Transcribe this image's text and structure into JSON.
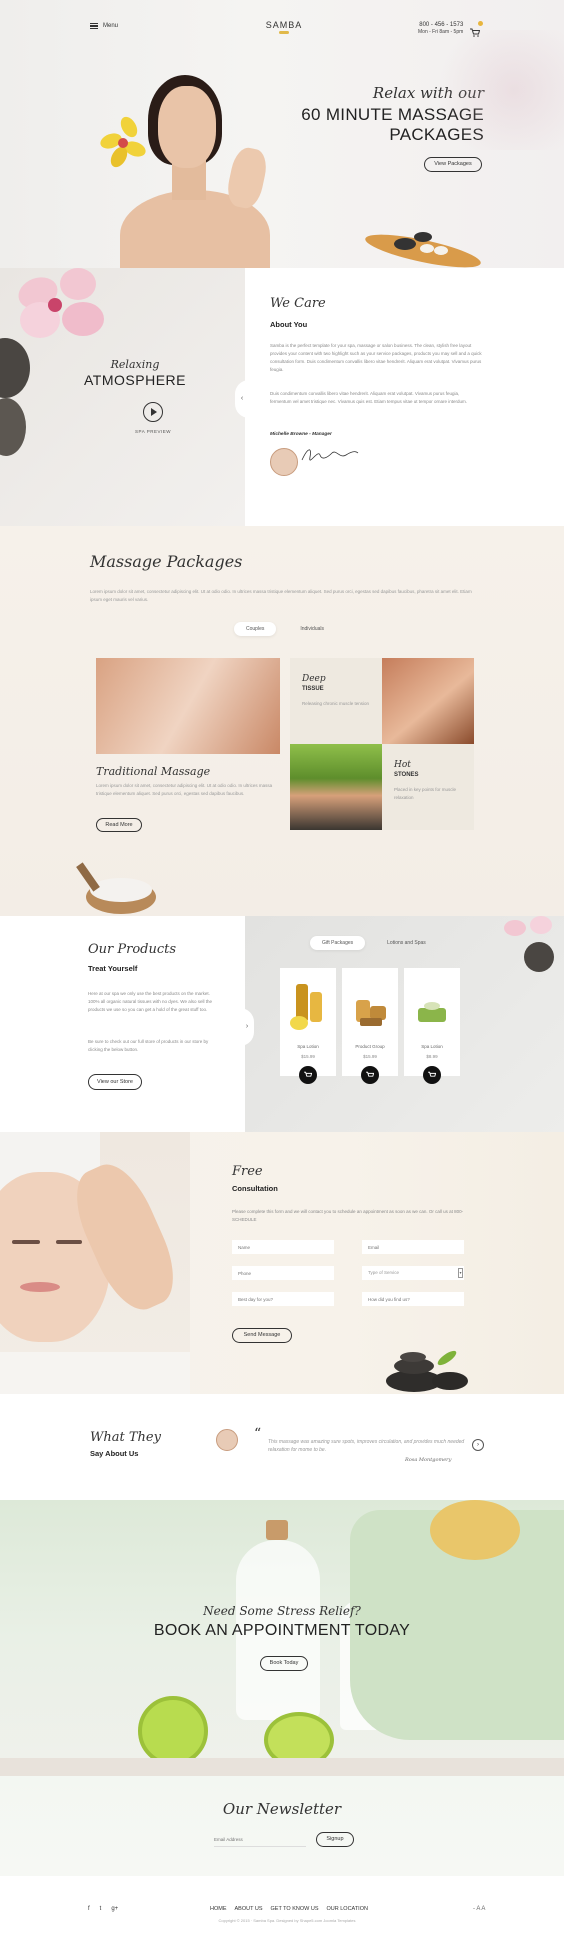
{
  "header": {
    "menu_label": "Menu",
    "logo": "SAMBA",
    "phone": "800 - 456 - 1573",
    "hours": "Mon - Fri 8am - 5pm"
  },
  "hero": {
    "subtitle": "Relax with our",
    "title_line1": "60 MINUTE MASSAGE",
    "title_line2": "PACKAGES",
    "button": "View Packages"
  },
  "atmosphere": {
    "script": "Relaxing",
    "title": "ATMOSPHERE",
    "preview_label": "SPA PREVIEW"
  },
  "about": {
    "script": "We Care",
    "title": "About You",
    "para1": "Samba is the perfect template for your spa, massage or salon business. The clean, stylish free layout provides your content with two highlight such as your service packages, products you may sell and a quick consultation form. Duis condimentum convallis libero vitae hendrerit. Aliquam erat volutpat. Vivamus purus feugia.",
    "para2": "Duis condimentum convallis libero vitae hendrerit. Aliquam erat volutpat. Vivamus purus feugia, fermentum vel amet tristique nec. Vivamus quis est. Etiam tempus vitae ut tempor ornare interdum.",
    "author": "Michelle Browne - Manager"
  },
  "packages": {
    "title": "Massage Packages",
    "desc": "Lorem ipsum dolor sit amet, consectetur adipiscing elit. Ut at odio odio. In ultrices massa tristique elementum aliquet. Sed purus orci, egestas sed dapibus faucibus, pharetra sit amet elit. Etiam ipsum eget mauris vel varius.",
    "tabs": [
      "Couples",
      "Individuals"
    ],
    "deep": {
      "script": "Deep",
      "title": "TISSUE",
      "desc": "Releasing chronic muscle tension"
    },
    "hot": {
      "script": "Hot",
      "title": "STONES",
      "desc": "Placed in key points for muscle relaxation"
    },
    "traditional": {
      "title": "Traditional Massage",
      "desc": "Lorem ipsum dolor sit amet, consectetur adipiscing elit. Ut at odio odio. In ultrices massa tristique elementum aliquet. Sed purus orci, egestas sed dapibus faucibus.",
      "button": "Read More"
    }
  },
  "products": {
    "script": "Our Products",
    "title": "Treat Yourself",
    "para1": "Here at our spa we only use the best products on the market. 100% all organic natural tissues with no dyes. We also sell the products we use so you can get a hold of the great stuff too.",
    "para2": "Be sure to check out our full store of products in our store by clicking the below button.",
    "button": "View our Store",
    "tabs": [
      "Gift Packages",
      "Lotions and Spas"
    ],
    "items": [
      {
        "name": "Spa Lotion",
        "price": "$15.99"
      },
      {
        "name": "Product Group",
        "price": "$15.99"
      },
      {
        "name": "Spa Lotion",
        "price": "$8.99"
      }
    ]
  },
  "consult": {
    "script": "Free",
    "title": "Consultation",
    "desc": "Please complete this form and we will contact you to schedule an appointment as soon as we can. Or call us at 800-SCHEDULE",
    "fields": {
      "name": "Name",
      "email": "Email",
      "phone": "Phone",
      "service": "Type of Service",
      "best_day": "Best day for you?",
      "heard": "How did you find us?"
    },
    "button": "Send Message"
  },
  "testimonial": {
    "script": "What They",
    "title": "Say About Us",
    "quote": "This massage was amazing sure spots, improves circulation, and provides much needed relaxation for mome to be.",
    "author": "Rosa Montgomery"
  },
  "book": {
    "subtitle": "Need Some Stress Relief?",
    "title": "BOOK AN APPOINTMENT TODAY",
    "button": "Book Today"
  },
  "newsletter": {
    "title": "Our Newsletter",
    "placeholder": "Email Address",
    "button": "Signup"
  },
  "footer": {
    "social": [
      "f",
      "t",
      "g+"
    ],
    "nav": [
      "HOME",
      "ABOUT US",
      "GET TO KNOW US",
      "OUR LOCATION"
    ],
    "copyright": "Copyright © 2015 · Samba Spa. Designed by Shape5.com Joomla Templates",
    "font_size_label": "- A A"
  },
  "colors": {
    "accent": "#e1b94a",
    "dark": "#222222",
    "cream": "#f6f1ea"
  }
}
